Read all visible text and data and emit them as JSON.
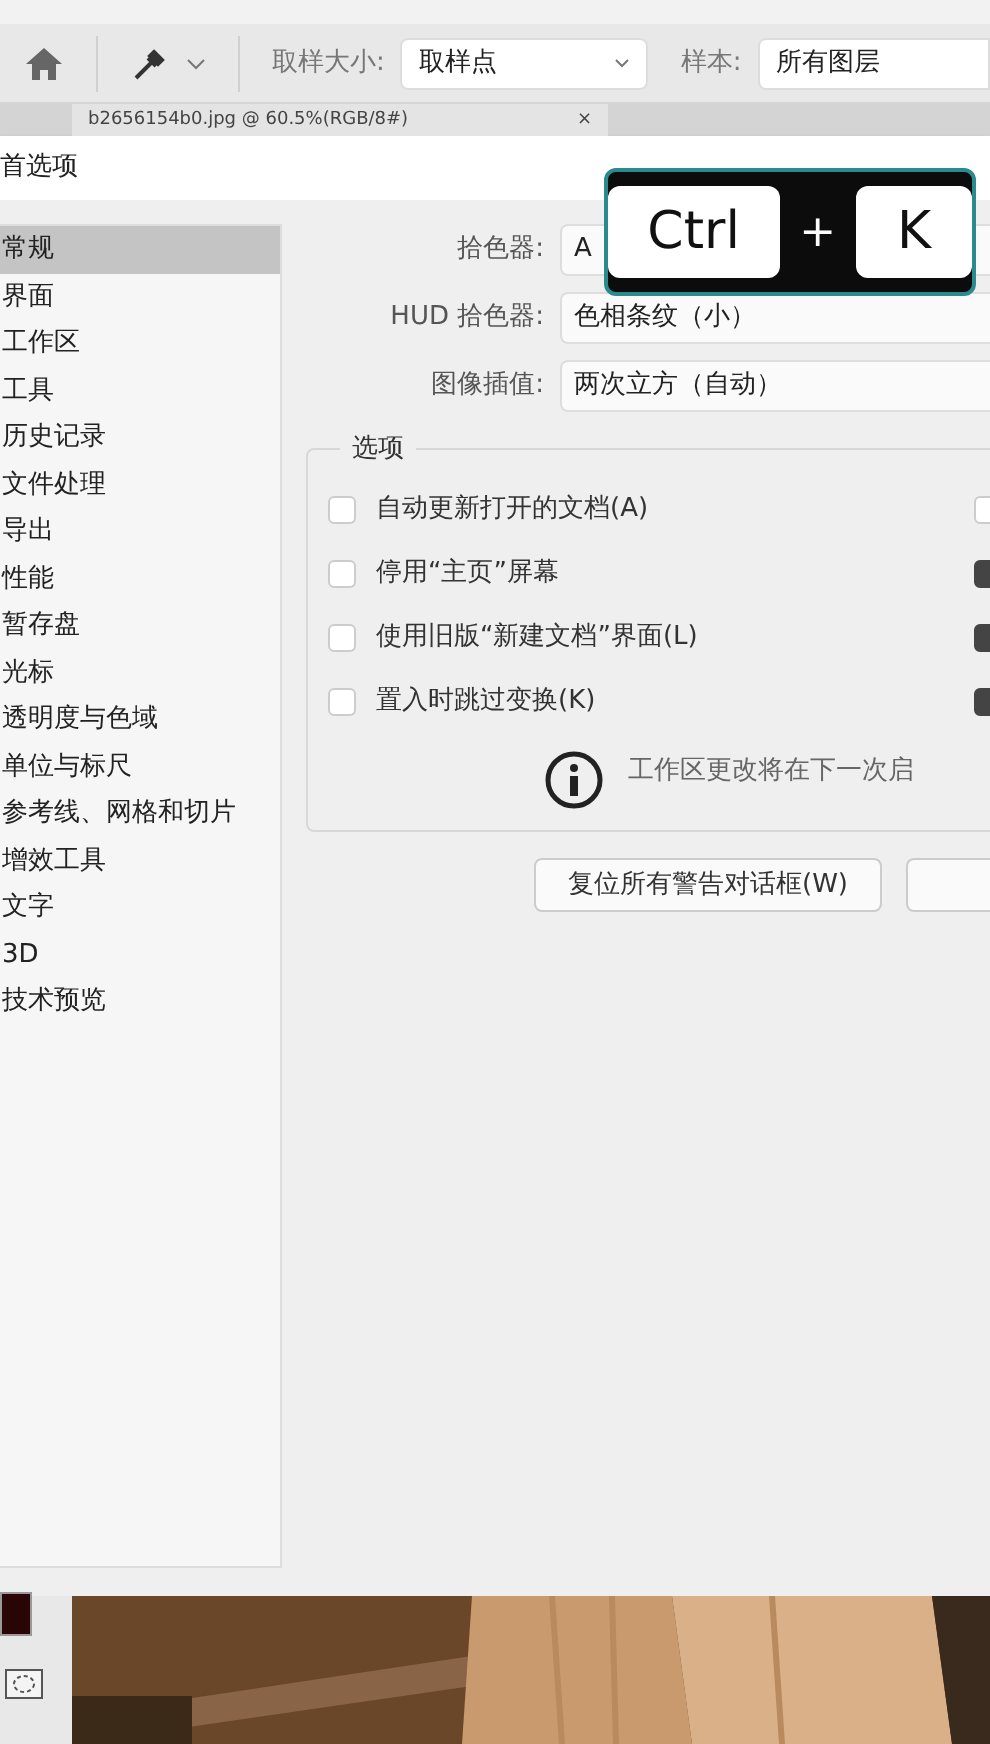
{
  "toolbar": {
    "sample_size_label": "取样大小:",
    "sample_size_value": "取样点",
    "sample_label": "样本:",
    "sample_value": "所有图层"
  },
  "document_tab": {
    "title": "b2656154b0.jpg @ 60.5%(RGB/8#)",
    "close": "×"
  },
  "dialog": {
    "title": "首选项",
    "sidebar": [
      {
        "label": "常规",
        "selected": true
      },
      {
        "label": "界面",
        "selected": false
      },
      {
        "label": "工作区",
        "selected": false
      },
      {
        "label": "工具",
        "selected": false
      },
      {
        "label": "历史记录",
        "selected": false
      },
      {
        "label": "文件处理",
        "selected": false
      },
      {
        "label": "导出",
        "selected": false
      },
      {
        "label": "性能",
        "selected": false
      },
      {
        "label": "暂存盘",
        "selected": false
      },
      {
        "label": "光标",
        "selected": false
      },
      {
        "label": "透明度与色域",
        "selected": false
      },
      {
        "label": "单位与标尺",
        "selected": false
      },
      {
        "label": "参考线、网格和切片",
        "selected": false
      },
      {
        "label": "增效工具",
        "selected": false
      },
      {
        "label": "文字",
        "selected": false
      },
      {
        "label": "3D",
        "selected": false
      },
      {
        "label": "技术预览",
        "selected": false
      }
    ],
    "fields": [
      {
        "label": "拾色器:",
        "value": "A"
      },
      {
        "label": "HUD 拾色器:",
        "value": "色相条纹（小）"
      },
      {
        "label": "图像插值:",
        "value": "两次立方（自动）"
      }
    ],
    "options_title": "选项",
    "options_left": [
      {
        "label": "自动更新打开的文档(A)",
        "checked": false
      },
      {
        "label": "停用“主页”屏幕",
        "checked": false
      },
      {
        "label": "使用旧版“新建文档”界面(L)",
        "checked": false
      },
      {
        "label": "置入时跳过变换(K)",
        "checked": false
      }
    ],
    "options_right": [
      {
        "checked": false
      },
      {
        "checked": true
      },
      {
        "checked": true
      },
      {
        "checked": true
      }
    ],
    "info": "工作区更改将在下一次启",
    "buttons": [
      "复位所有警告对话框(W)"
    ]
  },
  "shortcut": {
    "keys": [
      "Ctrl",
      "K"
    ],
    "joiner": "+"
  }
}
